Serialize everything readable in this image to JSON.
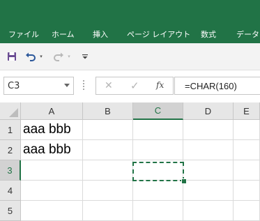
{
  "ribbon": {
    "tabs": [
      "ファイル",
      "ホーム",
      "挿入",
      "ページ レイアウト",
      "数式",
      "データ"
    ]
  },
  "quick_access": {
    "items": [
      "save-icon",
      "undo-icon",
      "redo-icon",
      "customize-icon"
    ]
  },
  "formula_bar": {
    "name_box": "C3",
    "formula": "=CHAR(160)",
    "cancel_glyph": "✕",
    "enter_glyph": "✓",
    "fx_glyph": "fx"
  },
  "sheet": {
    "columns": [
      "A",
      "B",
      "C",
      "D",
      "E"
    ],
    "rows": [
      "1",
      "2",
      "3",
      "4",
      "5"
    ],
    "cells": {
      "A1": "aaa bbb",
      "A2": "aaa bbb"
    },
    "selected_cell": "C3"
  },
  "colors": {
    "accent": "#217346",
    "header_bg": "#e6e6e6",
    "gridline": "#dadada"
  }
}
